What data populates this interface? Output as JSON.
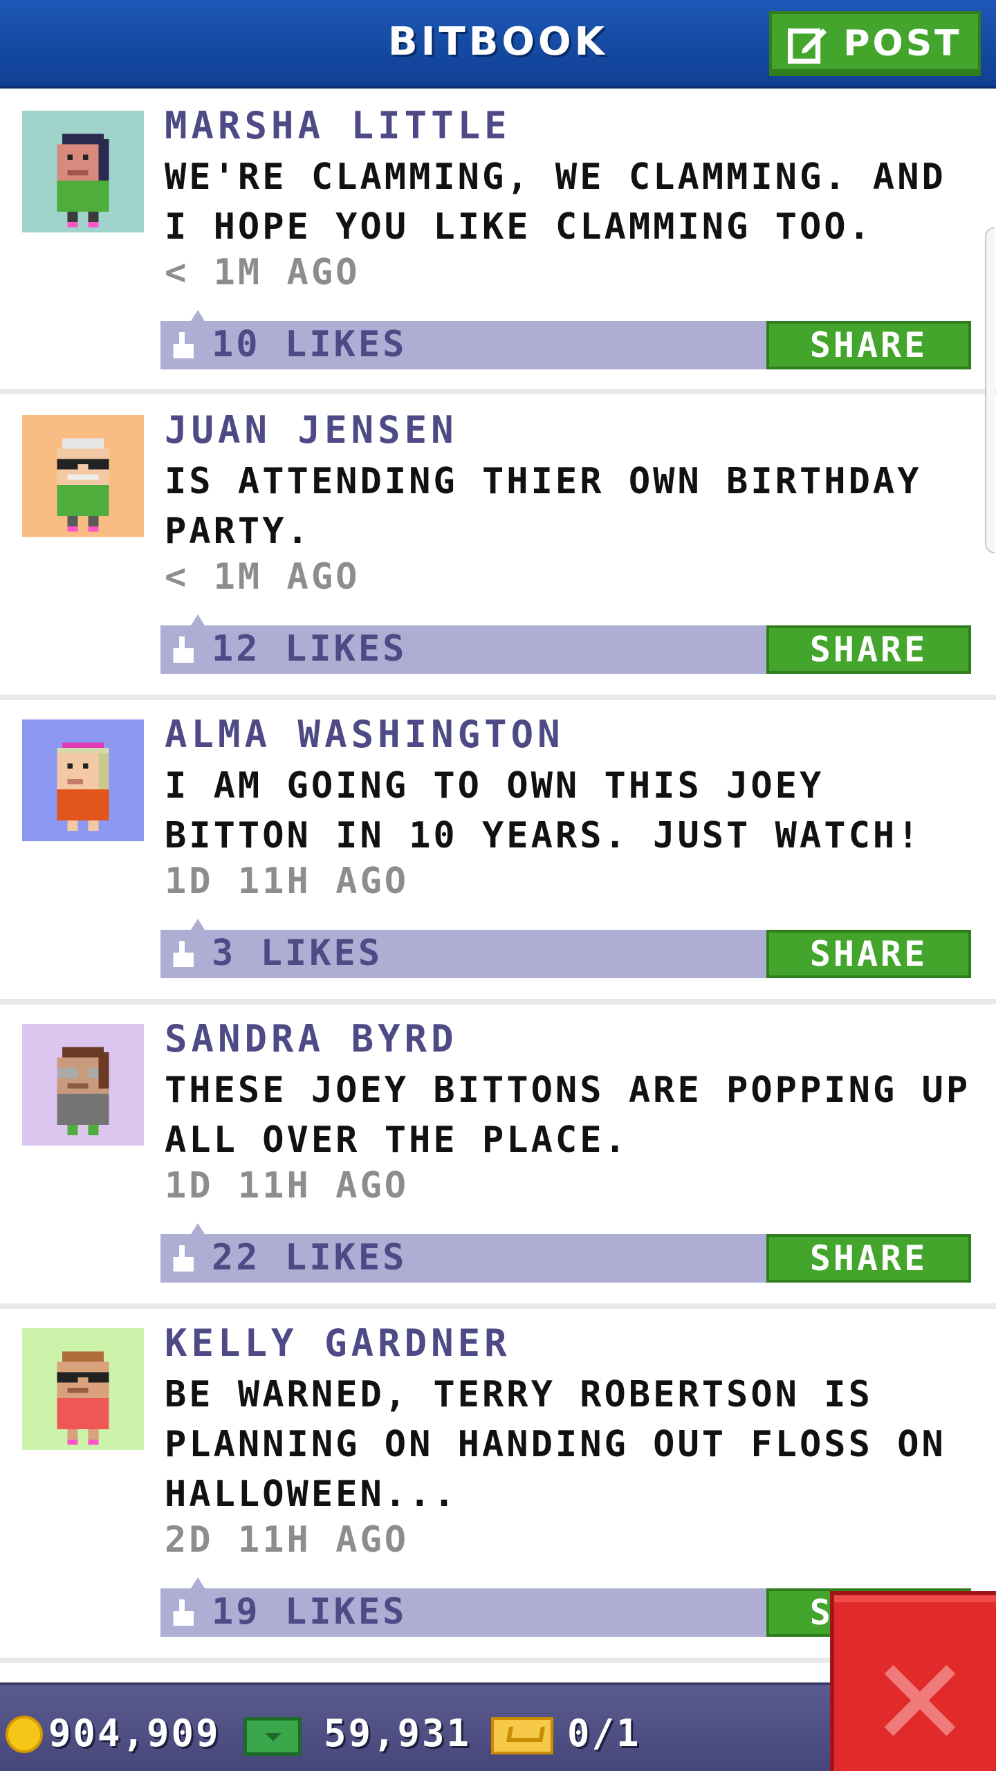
{
  "header": {
    "title": "BITBOOK",
    "post_label": "POST"
  },
  "posts": [
    {
      "name": "MARSHA LITTLE",
      "text": "WE'RE CLAMMING, WE CLAMMING. AND I HOPE YOU LIKE CLAMMING TOO.",
      "time": "< 1M AGO",
      "likes": "10 LIKES",
      "share": "SHARE",
      "avatar_bg": "#9fd3cb"
    },
    {
      "name": "JUAN JENSEN",
      "text": "IS ATTENDING THIER OWN BIRTHDAY PARTY.",
      "time": "< 1M AGO",
      "likes": "12 LIKES",
      "share": "SHARE",
      "avatar_bg": "#f9bd84"
    },
    {
      "name": "ALMA WASHINGTON",
      "text": "I AM GOING TO OWN THIS JOEY BITTON IN 10 YEARS. JUST WATCH!",
      "time": "1D 11H AGO",
      "likes": "3 LIKES",
      "share": "SHARE",
      "avatar_bg": "#8c98f1"
    },
    {
      "name": "SANDRA BYRD",
      "text": "THESE JOEY BITTONS ARE POPPING UP ALL OVER THE PLACE.",
      "time": "1D 11H AGO",
      "likes": "22 LIKES",
      "share": "SHARE",
      "avatar_bg": "#dcc6f0"
    },
    {
      "name": "KELLY GARDNER",
      "text": "BE WARNED, TERRY ROBERTSON IS PLANNING ON HANDING OUT FLOSS ON HALLOWEEN...",
      "time": "2D 11H AGO",
      "likes": "19 LIKES",
      "share": "SHARE",
      "avatar_bg": "#cdf2a9"
    }
  ],
  "status": {
    "coins": "904,909",
    "bux": "59,931",
    "tickets": "0/1"
  },
  "colors": {
    "header_blue": "#1a4fa8",
    "share_green": "#44a52d",
    "like_bar": "#aeaed4",
    "name_purple": "#4d4a86",
    "close_red": "#e12b2b"
  }
}
